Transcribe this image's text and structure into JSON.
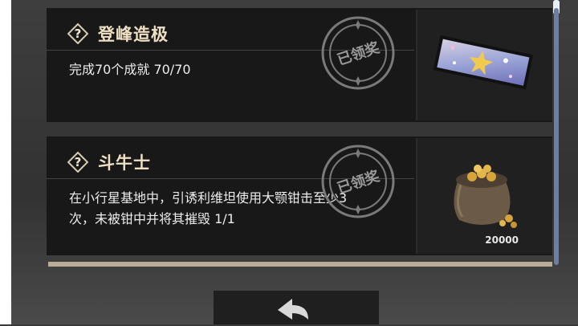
{
  "achievements": [
    {
      "title": "登峰造极",
      "description": "完成70个成就 70/70",
      "status": "已领奖",
      "reward": {
        "icon": "starry-ticket-icon",
        "quantity": ""
      }
    },
    {
      "title": "斗牛士",
      "description": "在小行星基地中，引诱利维坦使用大颚钳击至少3次，未被钳中并将其摧毁 1/1",
      "status": "已领奖",
      "reward": {
        "icon": "coin-sack-icon",
        "quantity": "20000"
      }
    }
  ],
  "colors": {
    "card_bg": "#181818",
    "title": "#efe0c4",
    "stamp": "#9a9a9a",
    "accent_strip": "#b9ad97"
  }
}
